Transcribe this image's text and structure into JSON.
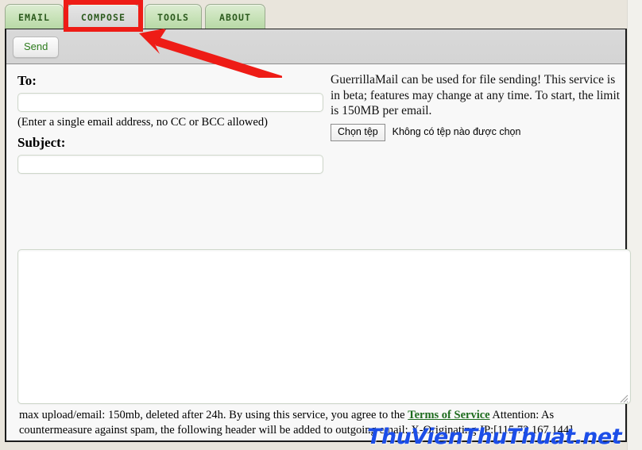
{
  "window": {
    "background_color": "#e9e5dc",
    "page_background": "#f8f8f8"
  },
  "tabs": [
    {
      "label": "EMAIL",
      "active": false
    },
    {
      "label": "COMPOSE",
      "active": true
    },
    {
      "label": "TOOLS",
      "active": false
    },
    {
      "label": "ABOUT",
      "active": false
    }
  ],
  "toolbar": {
    "send_label": "Send"
  },
  "compose": {
    "to_label": "To:",
    "to_value": "",
    "to_placeholder": "",
    "to_hint": "(Enter a single email address, no CC or BCC allowed)",
    "subject_label": "Subject:",
    "subject_value": "",
    "subject_placeholder": "",
    "body_value": "",
    "body_placeholder": ""
  },
  "attachment": {
    "notice": "GuerrillaMail can be used for file sending! This service is in beta; features may change at any time. To start, the limit is 150MB per email.",
    "choose_file_label": "Chọn tệp",
    "no_file_label": "Không có tệp nào được chọn"
  },
  "footer": {
    "text_before": "max upload/email: 150mb, deleted after 24h. By using this service, you agree to the ",
    "tos_link": "Terms of Service",
    "text_after": " Attention: As countermeasure against spam, the following header will be added to outgoing email: X-Originating-IP:[115.72.167.144]",
    "tos_color": "#1d6b1d"
  },
  "watermark": {
    "text": "ThuVienThuThuat.net",
    "color": "#1c4ee8"
  },
  "annotations": {
    "highlight_color": "#ee1c16",
    "highlight_target": "COMPOSE",
    "arrow_points_to": "COMPOSE"
  }
}
